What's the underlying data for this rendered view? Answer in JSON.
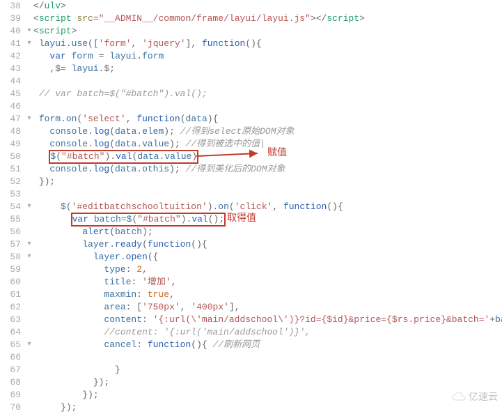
{
  "lines": [
    {
      "n": 38,
      "f": "",
      "html": "<span class='pun'>&lt;/</span><span class='tag'>ulv</span><span class='pun'>&gt;</span>"
    },
    {
      "n": 39,
      "f": "",
      "html": "<span class='pun'>&lt;</span><span class='tag'>script</span> <span class='attr'>src</span><span class='pun'>=</span><span class='str'>\"__ADMIN__/common/frame/layui/layui.js\"</span><span class='pun'>&gt;&lt;/</span><span class='tag'>script</span><span class='pun'>&gt;</span>"
    },
    {
      "n": 40,
      "f": "▾",
      "html": "<span class='pun'>&lt;</span><span class='tag'>script</span><span class='pun'>&gt;</span>"
    },
    {
      "n": 41,
      "f": "▾",
      "html": " <span class='ident'>layui</span><span class='pun'>.</span><span class='ident'>use</span><span class='pun'>([</span><span class='str'>'form'</span><span class='pun'>,</span> <span class='str'>'jquery'</span><span class='pun'>],</span> <span class='kw'>function</span><span class='pun'>(){</span>"
    },
    {
      "n": 42,
      "f": "",
      "html": "   <span class='kw'>var</span> <span class='ident'>form</span> <span class='pun'>=</span> <span class='ident'>layui</span><span class='pun'>.</span><span class='ident'>form</span>"
    },
    {
      "n": 43,
      "f": "",
      "html": "   <span class='pun'>,$=</span> <span class='ident'>layui</span><span class='pun'>.$;</span>"
    },
    {
      "n": 44,
      "f": "",
      "html": ""
    },
    {
      "n": 45,
      "f": "",
      "html": " <span class='com'>// var batch=$(\"#batch\").val();</span>"
    },
    {
      "n": 46,
      "f": "",
      "html": ""
    },
    {
      "n": 47,
      "f": "▾",
      "html": " <span class='ident'>form</span><span class='pun'>.</span><span class='ident'>on</span><span class='pun'>(</span><span class='str'>'select'</span><span class='pun'>,</span> <span class='kw'>function</span><span class='pun'>(</span><span class='ident'>data</span><span class='pun'>){</span>"
    },
    {
      "n": 48,
      "f": "",
      "html": "   <span class='ident'>console</span><span class='pun'>.</span><span class='func'>log</span><span class='pun'>(</span><span class='ident'>data</span><span class='pun'>.</span><span class='ident'>elem</span><span class='pun'>);</span> <span class='com'>//得到select原始DOM对象</span>"
    },
    {
      "n": 49,
      "f": "",
      "html": "   <span class='ident'>console</span><span class='pun'>.</span><span class='func'>log</span><span class='pun'>(</span><span class='ident'>data</span><span class='pun'>.</span><span class='ident'>value</span><span class='pun'>);</span> <span class='com'>//得到被选中的值|</span>"
    },
    {
      "n": 50,
      "f": "",
      "html": "   <span class='hl-box'><span class='ident'>$</span><span class='pun'>(</span><span class='str'>\"#batch\"</span><span class='pun'>).</span><span class='func'>val</span><span class='pun'>(</span><span class='ident'>data</span><span class='pun'>.</span><span class='ident'>value</span><span class='pun'>)</span></span>"
    },
    {
      "n": 51,
      "f": "",
      "html": "   <span class='ident'>console</span><span class='pun'>.</span><span class='func'>log</span><span class='pun'>(</span><span class='ident'>data</span><span class='pun'>.</span><span class='ident'>othis</span><span class='pun'>);</span> <span class='com'>//得到美化后的DOM对象</span>"
    },
    {
      "n": 52,
      "f": "",
      "html": " <span class='pun'>});</span>"
    },
    {
      "n": 53,
      "f": "",
      "html": ""
    },
    {
      "n": 54,
      "f": "▾",
      "html": "     <span class='ident'>$</span><span class='pun'>(</span><span class='str'>'#editbatchschooltuition'</span><span class='pun'>).</span><span class='ident'>on</span><span class='pun'>(</span><span class='str'>'click'</span><span class='pun'>,</span> <span class='kw'>function</span><span class='pun'>(){</span>"
    },
    {
      "n": 55,
      "f": "",
      "html": "       <span class='hl-box'><span class='kw'>var</span> <span class='ident'>batch</span><span class='pun'>=</span><span class='ident'>$</span><span class='pun'>(</span><span class='str'>\"#batch\"</span><span class='pun'>).</span><span class='func'>val</span><span class='pun'>();</span></span>"
    },
    {
      "n": 56,
      "f": "",
      "html": "         <span class='func'>alert</span><span class='pun'>(</span><span class='ident'>batch</span><span class='pun'>);</span>"
    },
    {
      "n": 57,
      "f": "▾",
      "html": "         <span class='ident'>layer</span><span class='pun'>.</span><span class='func'>ready</span><span class='pun'>(</span><span class='kw'>function</span><span class='pun'>(){</span>"
    },
    {
      "n": 58,
      "f": "▾",
      "html": "           <span class='ident'>layer</span><span class='pun'>.</span><span class='func'>open</span><span class='pun'>({</span>"
    },
    {
      "n": 59,
      "f": "",
      "html": "             <span class='ident'>type</span><span class='pun'>:</span> <span class='num'>2</span><span class='pun'>,</span>"
    },
    {
      "n": 60,
      "f": "",
      "html": "             <span class='ident'>title</span><span class='pun'>:</span> <span class='str'>'增加'</span><span class='pun'>,</span>"
    },
    {
      "n": 61,
      "f": "",
      "html": "             <span class='ident'>maxmin</span><span class='pun'>:</span> <span class='bool'>true</span><span class='pun'>,</span>"
    },
    {
      "n": 62,
      "f": "",
      "html": "             <span class='ident'>area</span><span class='pun'>:</span> <span class='pun'>[</span><span class='str'>'750px'</span><span class='pun'>,</span> <span class='str'>'400px'</span><span class='pun'>],</span>"
    },
    {
      "n": 63,
      "f": "",
      "html": "             <span class='ident'>content</span><span class='pun'>:</span> <span class='str'>'{:url(\\'main/addschool\\')}?id={$id}&amp;price={$rs.price}&amp;batch='</span><span class='pun'>+</span><span class='ident'>bat</span>"
    },
    {
      "n": 64,
      "f": "",
      "html": "             <span class='com'>//content: '{:url('main/addschool')}',</span>"
    },
    {
      "n": 65,
      "f": "▾",
      "html": "             <span class='ident'>cancel</span><span class='pun'>:</span> <span class='kw'>function</span><span class='pun'>(){</span> <span class='com'>//刷新网页</span>"
    },
    {
      "n": 66,
      "f": "",
      "html": ""
    },
    {
      "n": 67,
      "f": "",
      "html": "               <span class='pun'>}</span>"
    },
    {
      "n": 68,
      "f": "",
      "html": "           <span class='pun'>});</span>"
    },
    {
      "n": 69,
      "f": "",
      "html": "         <span class='pun'>});</span>"
    },
    {
      "n": 70,
      "f": "",
      "html": "     <span class='pun'>});</span>"
    }
  ],
  "annotations": {
    "ann1": "赋值",
    "ann2": "取得值"
  },
  "watermark": "亿速云"
}
